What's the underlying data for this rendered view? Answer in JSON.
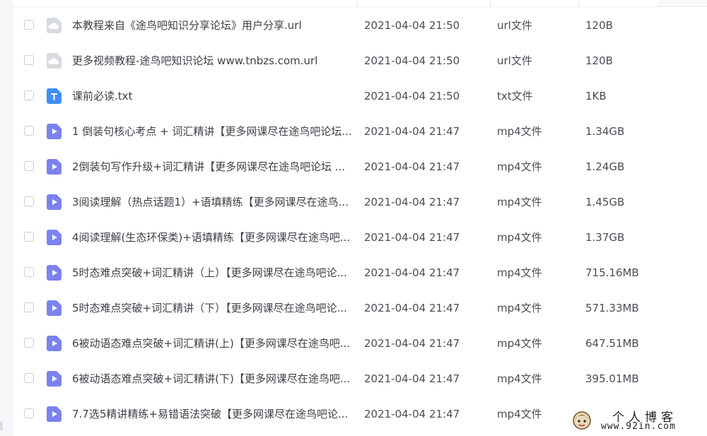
{
  "files": [
    {
      "icon": "link-file-icon",
      "name": "本教程来自《途鸟吧知识分享论坛》用户分享.url",
      "date": "2021-04-04 21:50",
      "type": "url文件",
      "size": "120B"
    },
    {
      "icon": "link-file-icon",
      "name": "更多视频教程-途鸟吧知识论坛 www.tnbzs.com.url",
      "date": "2021-04-04 21:50",
      "type": "url文件",
      "size": "120B"
    },
    {
      "icon": "text-file-icon",
      "name": "课前必读.txt",
      "date": "2021-04-04 21:50",
      "type": "txt文件",
      "size": "1KB"
    },
    {
      "icon": "video-file-icon",
      "name": "1 倒装句核心考点 + 词汇精讲【更多网课尽在途鸟吧论坛...",
      "date": "2021-04-04 21:47",
      "type": "mp4文件",
      "size": "1.34GB"
    },
    {
      "icon": "video-file-icon",
      "name": "2倒装句写作升级+词汇精讲【更多网课尽在途鸟吧论坛 ...",
      "date": "2021-04-04 21:47",
      "type": "mp4文件",
      "size": "1.24GB"
    },
    {
      "icon": "video-file-icon",
      "name": "3阅读理解（热点话题1）+语填精练【更多网课尽在途鸟...",
      "date": "2021-04-04 21:47",
      "type": "mp4文件",
      "size": "1.45GB"
    },
    {
      "icon": "video-file-icon",
      "name": "4阅读理解(生态环保类)+语填精练【更多网课尽在途鸟吧...",
      "date": "2021-04-04 21:47",
      "type": "mp4文件",
      "size": "1.37GB"
    },
    {
      "icon": "video-file-icon",
      "name": "5时态难点突破+词汇精讲（上）【更多网课尽在途鸟吧论...",
      "date": "2021-04-04 21:47",
      "type": "mp4文件",
      "size": "715.16MB"
    },
    {
      "icon": "video-file-icon",
      "name": "5时态难点突破+词汇精讲（下）【更多网课尽在途鸟吧论...",
      "date": "2021-04-04 21:47",
      "type": "mp4文件",
      "size": "571.33MB"
    },
    {
      "icon": "video-file-icon",
      "name": "6被动语态难点突破+词汇精讲(上)【更多网课尽在途鸟吧...",
      "date": "2021-04-04 21:47",
      "type": "mp4文件",
      "size": "647.51MB"
    },
    {
      "icon": "video-file-icon",
      "name": "6被动语态难点突破+词汇精讲(下)【更多网课尽在途鸟吧...",
      "date": "2021-04-04 21:47",
      "type": "mp4文件",
      "size": "395.01MB"
    },
    {
      "icon": "video-file-icon",
      "name": "7.7选5精讲精练+易错语法突破【更多网课尽在途鸟吧论...",
      "date": "2021-04-04 21:47",
      "type": "mp4文件",
      "size": ""
    }
  ],
  "watermark": {
    "title": "个人博客",
    "url": "www.92in.com"
  },
  "colors": {
    "video_icon": "#7b82f0",
    "text_icon": "#3d8ff5",
    "link_icon": "#d7dadf"
  }
}
